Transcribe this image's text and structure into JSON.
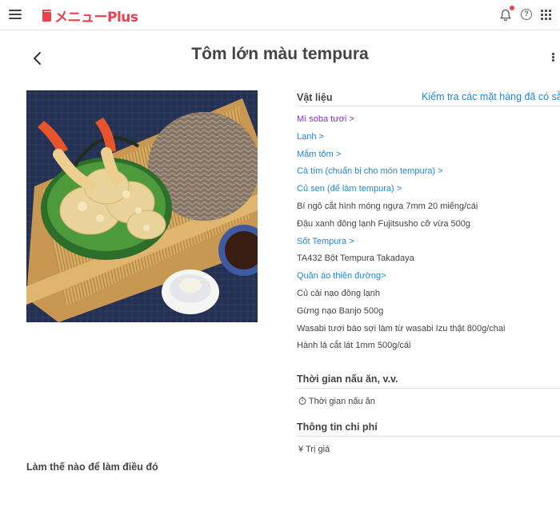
{
  "app": {
    "logo_text": "メニューPlus"
  },
  "header": {
    "title": "Tôm lớn màu tempura"
  },
  "colors": {
    "accent": "#e8424f",
    "link": "#1e88d8",
    "visited_link": "#8a2ee0",
    "text": "#444444"
  },
  "icons": {
    "menu": "hamburger-icon",
    "notifications": "bell-icon",
    "help": "question-circle-icon",
    "apps": "grid-icon",
    "back": "chevron-left-icon",
    "more": "kebab-icon",
    "timer": "stopwatch-icon"
  },
  "ingredients": {
    "heading": "Vật liệu",
    "check_link": "Kiểm tra các mặt hàng đã có sẵn",
    "items": [
      {
        "label": "Mì soba tươi >",
        "style": "visited"
      },
      {
        "label": "Lạnh >",
        "style": "link"
      },
      {
        "label": "Mắm tôm >",
        "style": "link"
      },
      {
        "label": "Cà tím (chuẩn bị cho món tempura) >",
        "style": "link"
      },
      {
        "label": "Củ sen (để làm tempura) >",
        "style": "link"
      },
      {
        "label": "Bí ngô cắt hình móng ngựa 7mm 20 miếng/cái",
        "style": "plain"
      },
      {
        "label": "Đậu xanh đông lạnh Fujitsusho cỡ vừa 500g",
        "style": "plain"
      },
      {
        "label": "Sốt Tempura >",
        "style": "link"
      },
      {
        "label": "TA432 Bột Tempura Takadaya",
        "style": "plain"
      },
      {
        "label": "Quần áo thiên đường>",
        "style": "link"
      },
      {
        "label": "Củ cải nạo đông lạnh",
        "style": "plain"
      },
      {
        "label": "Gừng nạo Banjo 500g",
        "style": "plain"
      },
      {
        "label": "Wasabi tươi bào sợi làm từ wasabi Izu thật 800g/chai",
        "style": "plain"
      },
      {
        "label": "Hành lá cắt lát 1mm 500g/cái",
        "style": "plain"
      }
    ]
  },
  "cooking_time": {
    "heading": "Thời gian nấu ăn, v.v.",
    "label": "Thời gian nấu ăn"
  },
  "cost": {
    "heading": "Thông tin chi phí",
    "label": "¥ Trị giá"
  },
  "howto": {
    "heading": "Làm thế nào để làm điều đó"
  }
}
